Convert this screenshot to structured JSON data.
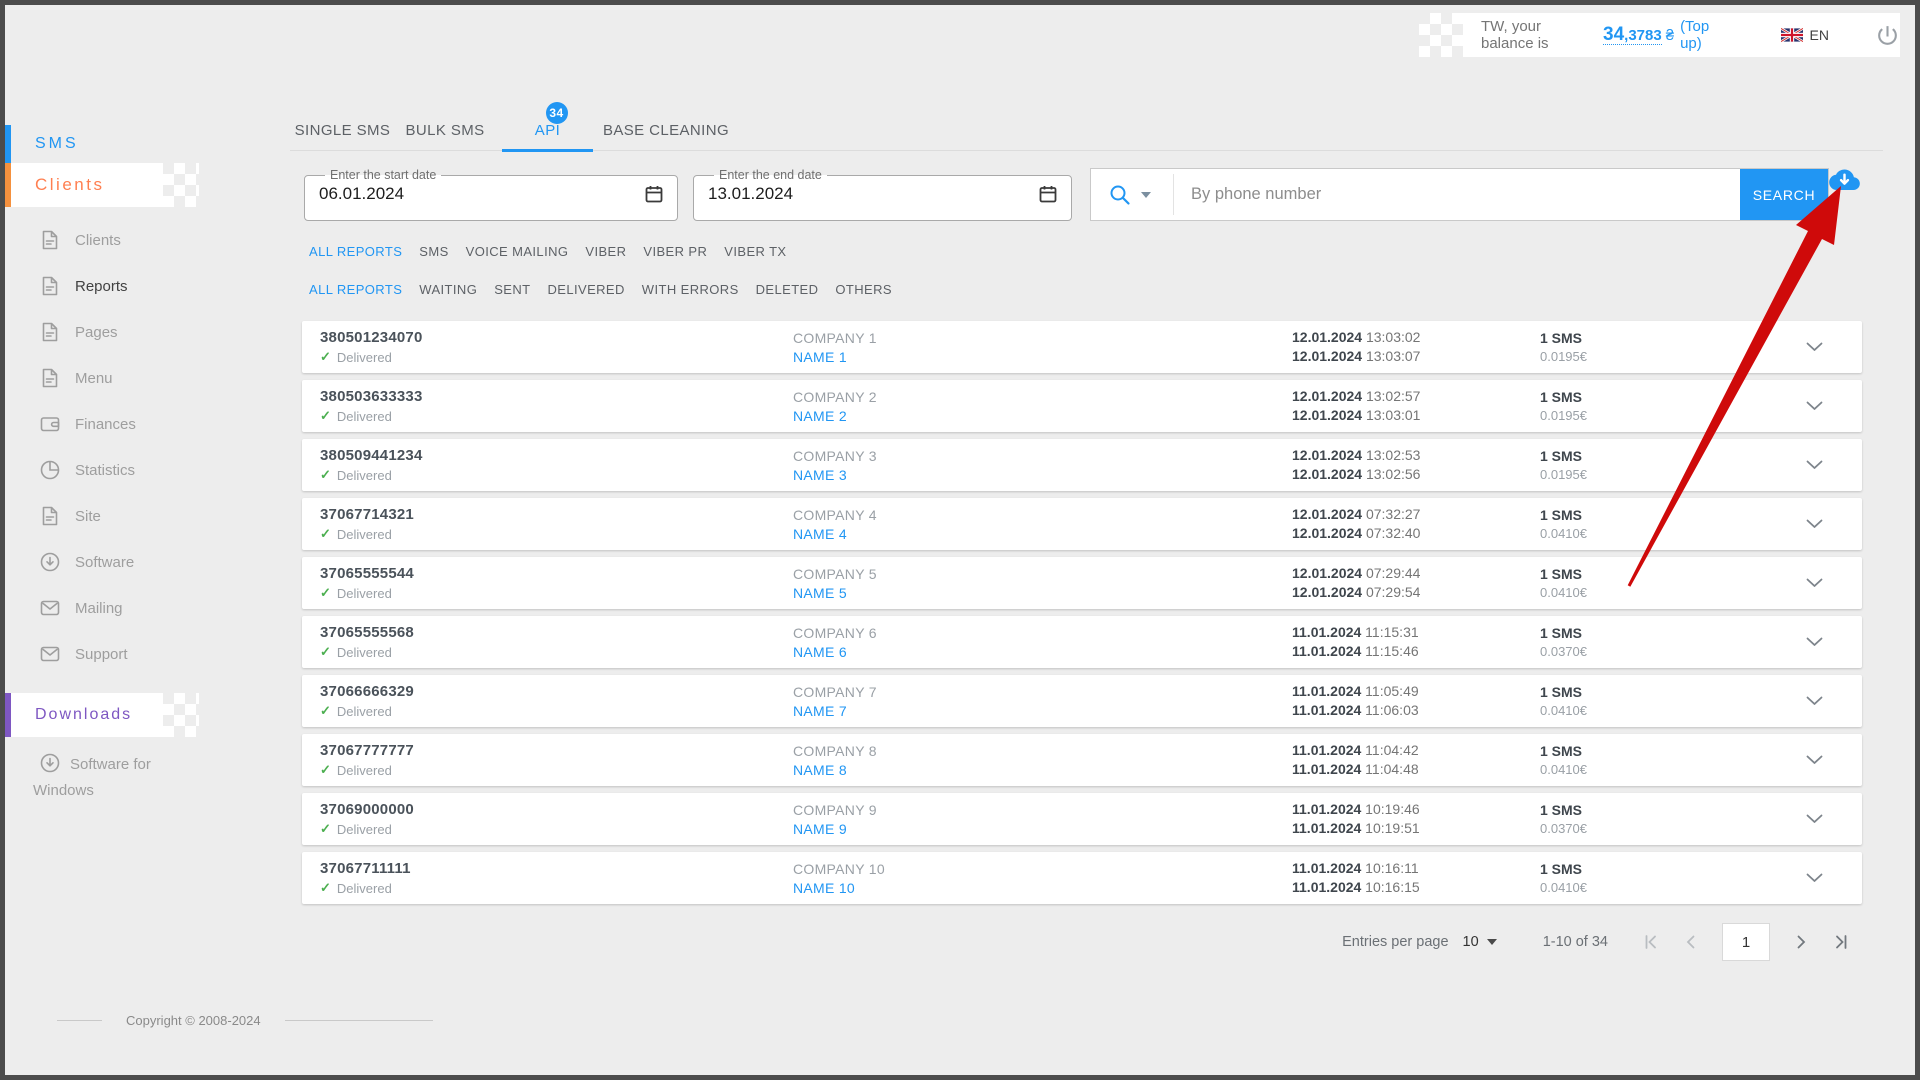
{
  "topbar": {
    "balance_prefix": "TW, your balance is",
    "balance_int": "34",
    "balance_dec": ",3783",
    "currency": "₴",
    "topup": "(Top up)",
    "language": "EN"
  },
  "sidebar": {
    "sections": {
      "sms": "SMS",
      "clients": "Clients",
      "downloads": "Downloads"
    },
    "items": [
      {
        "label": "Clients",
        "icon": "document-icon",
        "active": false
      },
      {
        "label": "Reports",
        "icon": "document-icon",
        "active": true
      },
      {
        "label": "Pages",
        "icon": "document-icon",
        "active": false
      },
      {
        "label": "Menu",
        "icon": "document-icon",
        "active": false
      },
      {
        "label": "Finances",
        "icon": "wallet-icon",
        "active": false
      },
      {
        "label": "Statistics",
        "icon": "pie-chart-icon",
        "active": false
      },
      {
        "label": "Site",
        "icon": "document-icon",
        "active": false
      },
      {
        "label": "Software",
        "icon": "download-circle-icon",
        "active": false
      },
      {
        "label": "Mailing",
        "icon": "envelope-icon",
        "active": false
      },
      {
        "label": "Support",
        "icon": "envelope-icon",
        "active": false
      }
    ],
    "downloads_items": [
      {
        "label": "Software for Windows",
        "icon": "download-circle-icon"
      }
    ]
  },
  "tabs": [
    {
      "label": "SINGLE SMS",
      "active": false
    },
    {
      "label": "BULK SMS",
      "active": false
    },
    {
      "label": "API",
      "active": true,
      "badge": "34"
    },
    {
      "label": "BASE CLEANING",
      "active": false
    }
  ],
  "date_filter": {
    "start_label": "Enter the start date",
    "start_value": "06.01.2024",
    "end_label": "Enter the end date",
    "end_value": "13.01.2024"
  },
  "search": {
    "placeholder": "By phone number",
    "button": "SEARCH"
  },
  "filters_channel": [
    {
      "label": "ALL REPORTS",
      "active": true
    },
    {
      "label": "SMS",
      "active": false
    },
    {
      "label": "VOICE MAILING",
      "active": false
    },
    {
      "label": "VIBER",
      "active": false
    },
    {
      "label": "VIBER PR",
      "active": false
    },
    {
      "label": "VIBER TX",
      "active": false
    }
  ],
  "filters_status": [
    {
      "label": "ALL REPORTS",
      "active": true
    },
    {
      "label": "WAITING",
      "active": false
    },
    {
      "label": "SENT",
      "active": false
    },
    {
      "label": "DELIVERED",
      "active": false
    },
    {
      "label": "WITH ERRORS",
      "active": false
    },
    {
      "label": "DELETED",
      "active": false
    },
    {
      "label": "OTHERS",
      "active": false
    }
  ],
  "reports": [
    {
      "phone": "380501234070",
      "status": "Delivered",
      "company": "COMPANY 1",
      "name": "NAME 1",
      "sent_date": "12.01.2024",
      "sent_time": "13:03:02",
      "delivered_date": "12.01.2024",
      "delivered_time": "13:03:07",
      "count": "1 SMS",
      "price": "0.0195€"
    },
    {
      "phone": "380503633333",
      "status": "Delivered",
      "company": "COMPANY 2",
      "name": "NAME 2",
      "sent_date": "12.01.2024",
      "sent_time": "13:02:57",
      "delivered_date": "12.01.2024",
      "delivered_time": "13:03:01",
      "count": "1 SMS",
      "price": "0.0195€"
    },
    {
      "phone": "380509441234",
      "status": "Delivered",
      "company": "COMPANY 3",
      "name": "NAME 3",
      "sent_date": "12.01.2024",
      "sent_time": "13:02:53",
      "delivered_date": "12.01.2024",
      "delivered_time": "13:02:56",
      "count": "1 SMS",
      "price": "0.0195€"
    },
    {
      "phone": "37067714321",
      "status": "Delivered",
      "company": "COMPANY 4",
      "name": "NAME 4",
      "sent_date": "12.01.2024",
      "sent_time": "07:32:27",
      "delivered_date": "12.01.2024",
      "delivered_time": "07:32:40",
      "count": "1 SMS",
      "price": "0.0410€"
    },
    {
      "phone": "37065555544",
      "status": "Delivered",
      "company": "COMPANY 5",
      "name": "NAME 5",
      "sent_date": "12.01.2024",
      "sent_time": "07:29:44",
      "delivered_date": "12.01.2024",
      "delivered_time": "07:29:54",
      "count": "1 SMS",
      "price": "0.0410€"
    },
    {
      "phone": "37065555568",
      "status": "Delivered",
      "company": "COMPANY 6",
      "name": "NAME 6",
      "sent_date": "11.01.2024",
      "sent_time": "11:15:31",
      "delivered_date": "11.01.2024",
      "delivered_time": "11:15:46",
      "count": "1 SMS",
      "price": "0.0370€"
    },
    {
      "phone": "37066666329",
      "status": "Delivered",
      "company": "COMPANY 7",
      "name": "NAME 7",
      "sent_date": "11.01.2024",
      "sent_time": "11:05:49",
      "delivered_date": "11.01.2024",
      "delivered_time": "11:06:03",
      "count": "1 SMS",
      "price": "0.0410€"
    },
    {
      "phone": "37067777777",
      "status": "Delivered",
      "company": "COMPANY 8",
      "name": "NAME 8",
      "sent_date": "11.01.2024",
      "sent_time": "11:04:42",
      "delivered_date": "11.01.2024",
      "delivered_time": "11:04:48",
      "count": "1 SMS",
      "price": "0.0410€"
    },
    {
      "phone": "37069000000",
      "status": "Delivered",
      "company": "COMPANY 9",
      "name": "NAME 9",
      "sent_date": "11.01.2024",
      "sent_time": "10:19:46",
      "delivered_date": "11.01.2024",
      "delivered_time": "10:19:51",
      "count": "1 SMS",
      "price": "0.0370€"
    },
    {
      "phone": "37067711111",
      "status": "Delivered",
      "company": "COMPANY 10",
      "name": "NAME 10",
      "sent_date": "11.01.2024",
      "sent_time": "10:16:11",
      "delivered_date": "11.01.2024",
      "delivered_time": "10:16:15",
      "count": "1 SMS",
      "price": "0.0410€"
    }
  ],
  "pagination": {
    "entries_label": "Entries per page",
    "per_page": "10",
    "range": "1-10 of 34",
    "page": "1"
  },
  "footer": {
    "copyright": "Copyright © 2008-2024"
  },
  "colors": {
    "accent_blue": "#2196f3",
    "clients_orange": "#ff7f50",
    "downloads_purple": "#7e57c2",
    "delivered_green": "#4caf50",
    "annotation_red": "#cf0a0a",
    "page_background": "#ededed"
  }
}
